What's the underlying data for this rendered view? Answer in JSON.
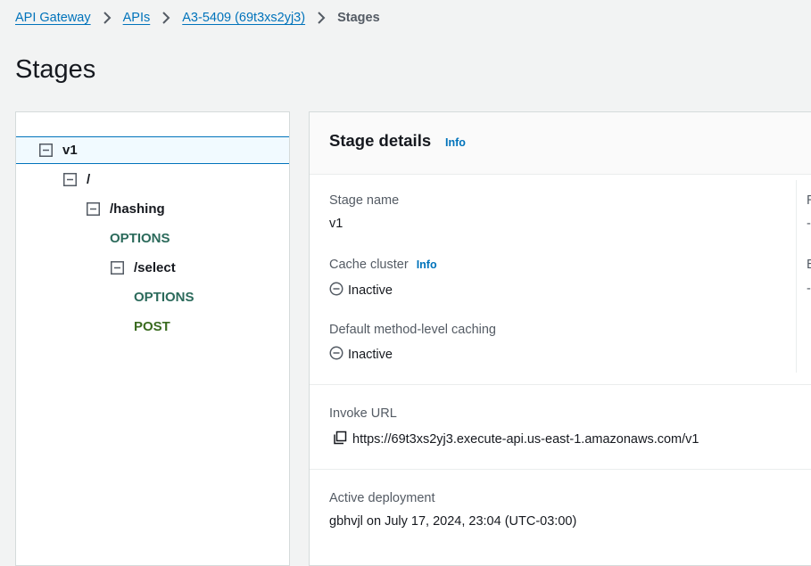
{
  "breadcrumbs": {
    "items": [
      "API Gateway",
      "APIs",
      "A3-5409 (69t3xs2yj3)"
    ],
    "current": "Stages"
  },
  "page": {
    "title": "Stages"
  },
  "tree": {
    "nodes": [
      {
        "label": "v1"
      },
      {
        "label": "/"
      },
      {
        "label": "/hashing"
      },
      {
        "label": "OPTIONS"
      },
      {
        "label": "/select"
      },
      {
        "label": "OPTIONS"
      },
      {
        "label": "POST"
      }
    ]
  },
  "details": {
    "title": "Stage details",
    "info_label": "Info",
    "stage_name_label": "Stage name",
    "stage_name_value": "v1",
    "cache_cluster_label": "Cache cluster",
    "cache_cluster_info": "Info",
    "cache_cluster_value": "Inactive",
    "default_caching_label": "Default method-level caching",
    "default_caching_value": "Inactive",
    "invoke_url_label": "Invoke URL",
    "invoke_url_value": "https://69t3xs2yj3.execute-api.us-east-1.amazonaws.com/v1",
    "active_deployment_label": "Active deployment",
    "active_deployment_value": "gbhvjl on July 17, 2024, 23:04 (UTC-03:00)",
    "right_column_fragments": [
      "R",
      "-",
      "E",
      "-"
    ]
  },
  "colors": {
    "link": "#0073bb",
    "selected_bg": "#f1faff",
    "method_green": "#2b6a5b"
  }
}
